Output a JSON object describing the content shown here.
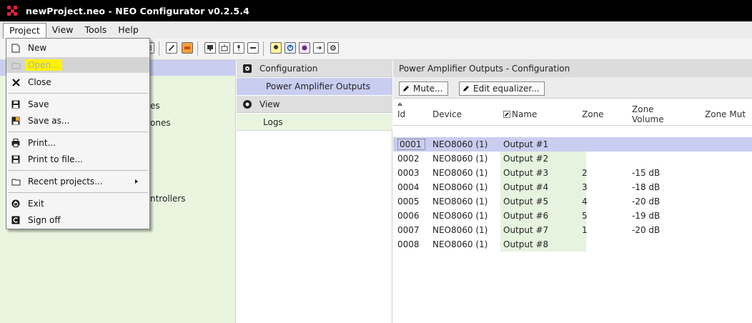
{
  "window": {
    "title": "newProject.neo - NEO Configurator v0.2.5.4"
  },
  "menubar": [
    "Project",
    "View",
    "Tools",
    "Help"
  ],
  "project_menu": [
    {
      "label": "New",
      "icon": "new-file-icon",
      "enabled": true
    },
    {
      "label": "Open...",
      "icon": "open-folder-icon",
      "enabled": false
    },
    {
      "label": "Close",
      "icon": "close-icon",
      "enabled": true
    },
    {
      "label": "Save",
      "icon": "save-icon",
      "enabled": true
    },
    {
      "label": "Save as...",
      "icon": "save-as-icon",
      "enabled": true
    },
    {
      "label": "Print...",
      "icon": "print-icon",
      "enabled": true
    },
    {
      "label": "Print to file...",
      "icon": "print-to-file-icon",
      "enabled": true
    },
    {
      "label": "Recent projects...",
      "icon": "recent-folder-icon",
      "enabled": true,
      "submenu": true
    },
    {
      "label": "Exit",
      "icon": "power-icon",
      "enabled": true
    },
    {
      "label": "Sign off",
      "icon": "sign-off-icon",
      "enabled": true
    }
  ],
  "tree_fragments": [
    "es",
    "ones",
    "ntrollers"
  ],
  "nav": {
    "configuration": "Configuration",
    "power_amp_outputs": "Power Amplifier Outputs",
    "view": "View",
    "logs": "Logs"
  },
  "content": {
    "header": "Power Amplifier Outputs - Configuration",
    "mute_button": "Mute...",
    "edit_eq_button": "Edit equalizer...",
    "columns": {
      "id": "Id",
      "device": "Device",
      "name": "Name",
      "zone": "Zone",
      "zone_volume": "Zone Volume",
      "zone_mute": "Zone Mut"
    },
    "rows": [
      {
        "id": "0001",
        "device": "NEO8060 (1)",
        "name": "Output #1",
        "zone": "",
        "volume": ""
      },
      {
        "id": "0002",
        "device": "NEO8060 (1)",
        "name": "Output #2",
        "zone": "",
        "volume": ""
      },
      {
        "id": "0003",
        "device": "NEO8060 (1)",
        "name": "Output #3",
        "zone": "2",
        "volume": "-15 dB"
      },
      {
        "id": "0004",
        "device": "NEO8060 (1)",
        "name": "Output #4",
        "zone": "3",
        "volume": "-18 dB"
      },
      {
        "id": "0005",
        "device": "NEO8060 (1)",
        "name": "Output #5",
        "zone": "4",
        "volume": "-20 dB"
      },
      {
        "id": "0006",
        "device": "NEO8060 (1)",
        "name": "Output #6",
        "zone": "5",
        "volume": "-19 dB"
      },
      {
        "id": "0007",
        "device": "NEO8060 (1)",
        "name": "Output #7",
        "zone": "1",
        "volume": "-20 dB"
      },
      {
        "id": "0008",
        "device": "NEO8060 (1)",
        "name": "Output #8",
        "zone": "",
        "volume": ""
      }
    ]
  },
  "colors": {
    "selection": "#c9cdf0",
    "tree_bg": "#eaf5df",
    "logo_red": "#e2213b",
    "highlight": "#fff200"
  }
}
